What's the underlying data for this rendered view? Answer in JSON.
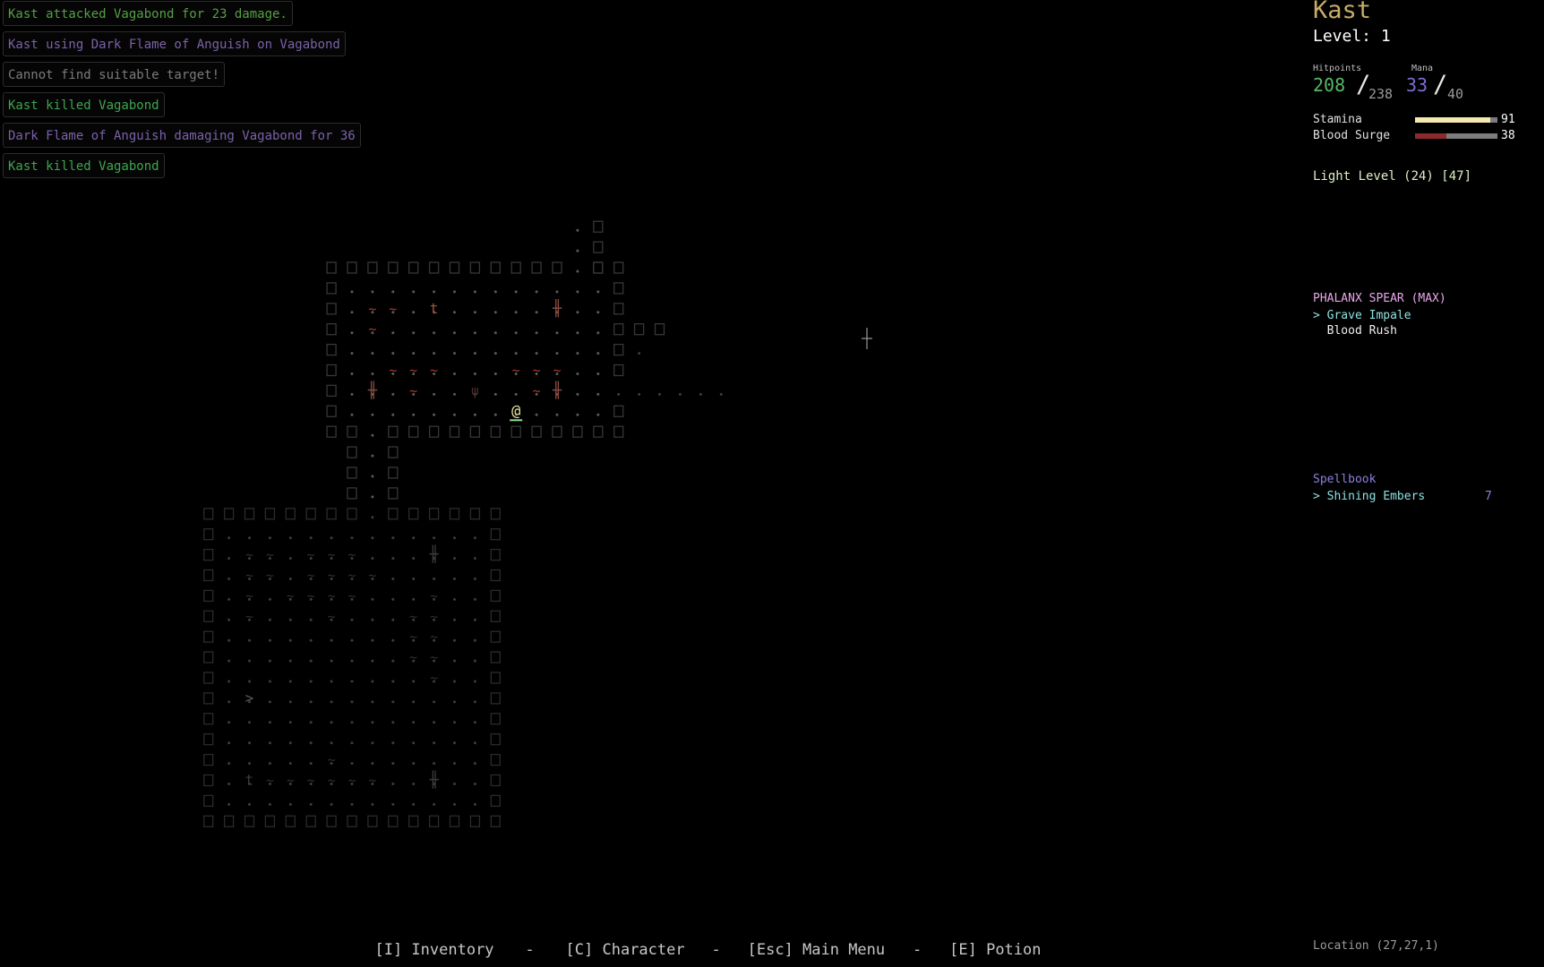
{
  "message_log": [
    {
      "text": "Kast attacked Vagabond for 23 damage.",
      "kind": "attack"
    },
    {
      "text": "Kast using Dark Flame of Anguish on Vagabond",
      "kind": "spell"
    },
    {
      "text": "Cannot find suitable target!",
      "kind": "warn"
    },
    {
      "text": "Kast killed Vagabond",
      "kind": "kill"
    },
    {
      "text": "Dark Flame of Anguish damaging Vagabond for 36",
      "kind": "spell"
    },
    {
      "text": "Kast killed Vagabond",
      "kind": "kill"
    }
  ],
  "character": {
    "name": "Kast",
    "level_text": "Level: 1",
    "hitpoints_label": "Hitpoints",
    "hp_current": "208",
    "hp_max": "238",
    "mana_label": "Mana",
    "mana_current": "33",
    "mana_max": "40",
    "slash": "/",
    "stamina_label": "Stamina",
    "stamina_value": "91",
    "stamina_fraction": 0.91,
    "blood_surge_label": "Blood Surge",
    "blood_surge_value": "38",
    "blood_surge_fraction": 0.38,
    "light_level_text": "Light Level (24) [47]"
  },
  "weapon": {
    "title": "PHALANX SPEAR (MAX)",
    "skills": [
      {
        "text": "> Grave Impale",
        "selected": true
      },
      {
        "text": "  Blood Rush",
        "selected": false
      }
    ]
  },
  "spellbook": {
    "title": "Spellbook",
    "spells": [
      {
        "text": "> Shining Embers",
        "count": "7"
      }
    ]
  },
  "location_text": "Location (27,27,1)",
  "commands": [
    "[I] Inventory",
    "[C] Character",
    "[Esc] Main Menu",
    "[E] Potion"
  ],
  "command_separator": "-",
  "colors": {
    "stamina_bar": "#f4eab0",
    "blood_surge_bar": "#8b2b2b",
    "hp_number": "#59b765",
    "mana_number": "#7b6dd6",
    "player": "#e8e1a0",
    "water": "#b23a28",
    "wall": "#3a3a3a"
  },
  "map": {
    "rows": [
      ".                          ",
      "                           "
    ],
    "player_glyph": "@",
    "cursor_glyph": "┼"
  }
}
